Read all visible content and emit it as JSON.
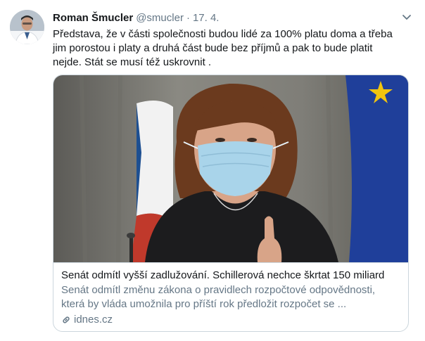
{
  "author": {
    "name": "Roman Šmucler",
    "handle": "@smucler",
    "separator": "·",
    "date": "17. 4."
  },
  "tweet": {
    "text": "Představa, že v části společnosti budou lidé za 100% platu doma a třeba\njim porostou i platy a druhá část  bude bez příjmů a pak to bude platit\nnejde. Stát se musí též uskrovnit ."
  },
  "card": {
    "title": "Senát odmítl vyšší zadlužování. Schillerová nechce škrtat 150 miliard",
    "description": "Senát odmítl změnu zákona o pravidlech rozpočtové odpovědnosti, která by vláda umožnila pro příští rok předložit rozpočet se ...",
    "domain": "idnes.cz",
    "domain_icon": "link-icon",
    "image_icon": "photo-woman-in-face-mask"
  },
  "icons": {
    "avatar": "avatar-photo",
    "menu": "chevron-down-icon"
  },
  "colors": {
    "text": "#14171a",
    "secondary": "#657786",
    "border": "#ccd6dd"
  }
}
